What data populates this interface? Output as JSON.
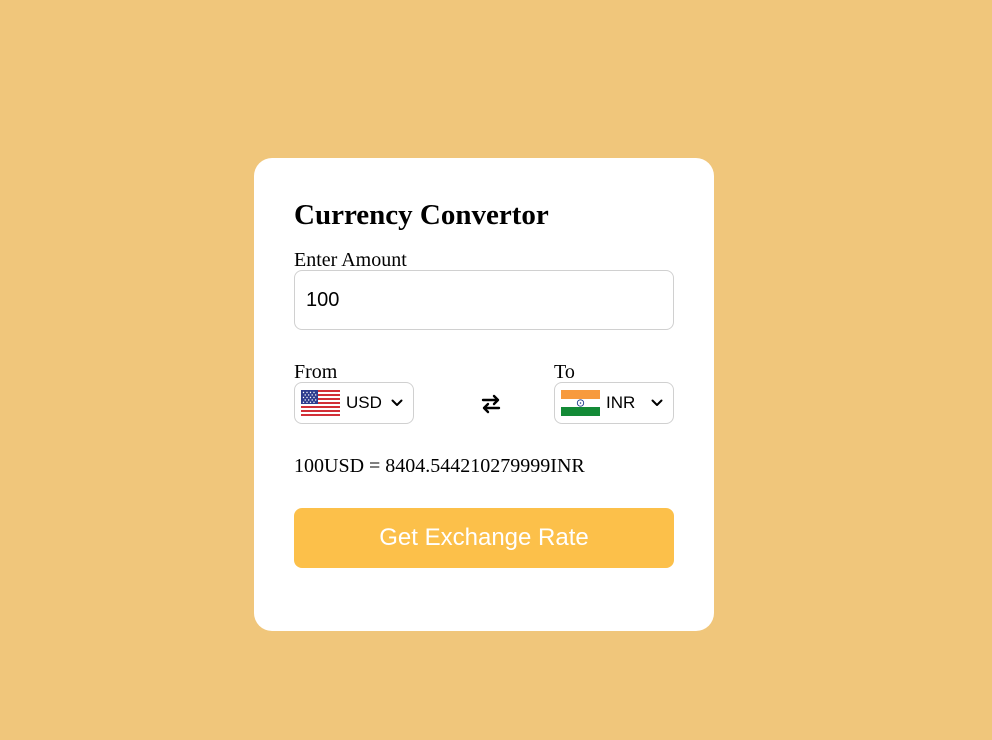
{
  "title": "Currency Convertor",
  "amount": {
    "label": "Enter Amount",
    "value": "100"
  },
  "from": {
    "label": "From",
    "currency": "USD",
    "flag_icon": "us-flag-icon"
  },
  "to": {
    "label": "To",
    "currency": "INR",
    "flag_icon": "india-flag-icon"
  },
  "swap_icon": "swap-arrows-icon",
  "result_text": "100USD = 8404.544210279999INR",
  "button_label": "Get Exchange Rate",
  "colors": {
    "background": "#f0c67b",
    "card": "#ffffff",
    "button": "#fcc04a",
    "button_text": "#ffffff"
  }
}
